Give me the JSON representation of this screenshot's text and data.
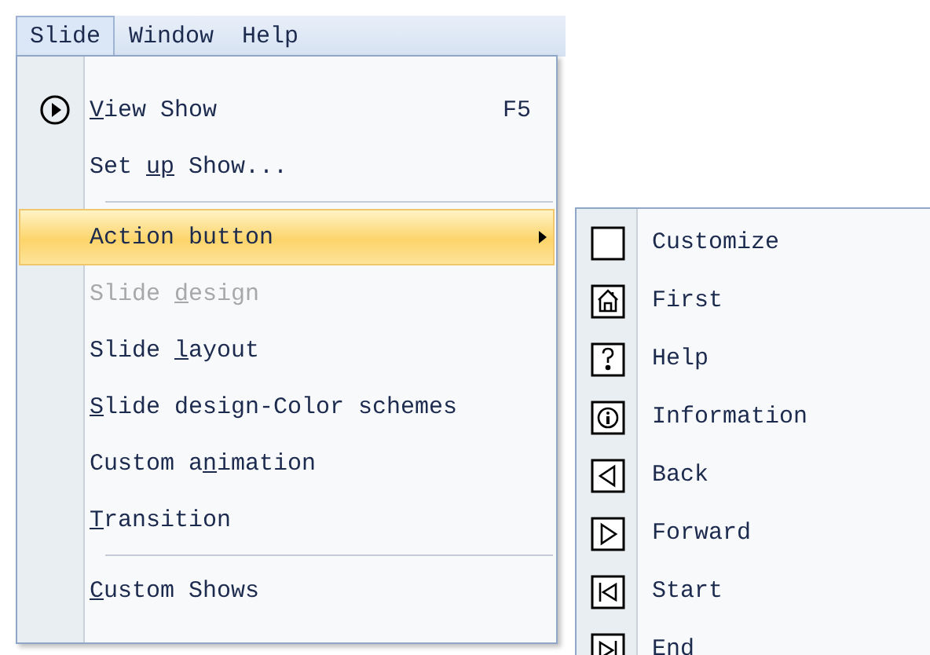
{
  "menu_bar": [
    {
      "label": "Slide",
      "selected": true
    },
    {
      "label": "Window",
      "selected": false
    },
    {
      "label": "Help",
      "selected": false
    }
  ],
  "menu": [
    {
      "kind": "item",
      "key": "V",
      "post": "iew Show",
      "shortcut": "F5",
      "selected": false,
      "disabled": false,
      "submenu": false
    },
    {
      "kind": "item",
      "pre": "Set ",
      "key": "up",
      "post": " Show...",
      "selected": false,
      "disabled": false,
      "submenu": false
    },
    {
      "kind": "separator"
    },
    {
      "kind": "item",
      "pre": "Action button",
      "selected": true,
      "disabled": false,
      "submenu": true
    },
    {
      "kind": "item",
      "pre": "Slide ",
      "key": "d",
      "post": "esign",
      "selected": false,
      "disabled": true,
      "submenu": false
    },
    {
      "kind": "item",
      "pre": "Slide ",
      "key": "l",
      "post": "ayout",
      "selected": false,
      "disabled": false,
      "submenu": false
    },
    {
      "kind": "item",
      "key": "S",
      "post": "lide design-Color schemes",
      "selected": false,
      "disabled": false,
      "submenu": false
    },
    {
      "kind": "item",
      "pre": "Custom a",
      "key": "n",
      "post": "imation",
      "selected": false,
      "disabled": false,
      "submenu": false
    },
    {
      "kind": "item",
      "key": "T",
      "post": "ransition",
      "selected": false,
      "disabled": false,
      "submenu": false
    },
    {
      "kind": "separator"
    },
    {
      "kind": "item",
      "key": "C",
      "post": "ustom Shows",
      "selected": false,
      "disabled": false,
      "submenu": false
    }
  ],
  "submenu": [
    {
      "label": "Customize"
    },
    {
      "label": "First"
    },
    {
      "label": "Help"
    },
    {
      "label": "Information"
    },
    {
      "label": "Back"
    },
    {
      "label": "Forward"
    },
    {
      "label": "Start"
    },
    {
      "label": "End"
    }
  ]
}
